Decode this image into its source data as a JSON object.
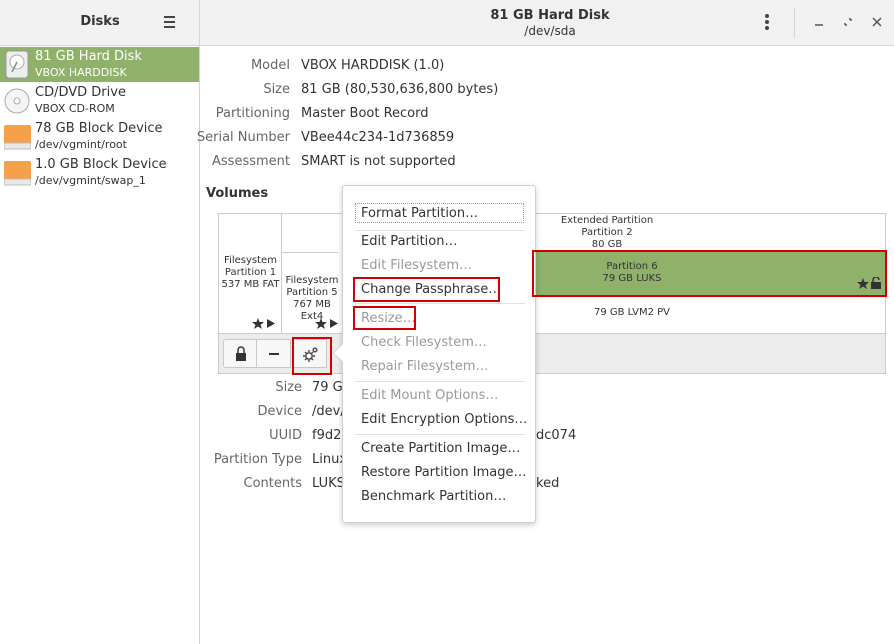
{
  "sidebar": {
    "title": "Disks",
    "menu_icon": "hamburger-icon",
    "items": [
      {
        "name": "81 GB Hard Disk",
        "sub": "VBOX HARDDISK",
        "icon": "harddisk-icon",
        "selected": true
      },
      {
        "name": "CD/DVD Drive",
        "sub": "VBOX CD-ROM",
        "icon": "optical-disc-icon"
      },
      {
        "name": "78 GB Block Device",
        "sub": "/dev/vgmint/root",
        "icon": "block-device-icon"
      },
      {
        "name": "1.0 GB Block Device",
        "sub": "/dev/vgmint/swap_1",
        "icon": "block-device-icon"
      }
    ]
  },
  "header": {
    "title": "81 GB Hard Disk",
    "subtitle": "/dev/sda",
    "icons": [
      "kebab-menu-icon",
      "minimize-icon",
      "restore-icon",
      "close-icon"
    ]
  },
  "disk_info": {
    "model_label": "Model",
    "model": "VBOX HARDDISK (1.0)",
    "size_label": "Size",
    "size": "81 GB (80,530,636,800 bytes)",
    "partitioning_label": "Partitioning",
    "partitioning": "Master Boot Record",
    "serial_label": "Serial Number",
    "serial": "VBee44c234-1d736859",
    "assessment_label": "Assessment",
    "assessment": "SMART is not supported"
  },
  "volumes": {
    "label": "Volumes",
    "p1": {
      "l1": "Filesystem",
      "l2": "Partition 1",
      "l3": "537 MB FAT"
    },
    "p5": {
      "l1": "Filesystem",
      "l2": "Partition 5",
      "l3": "767 MB Ext4"
    },
    "ext": {
      "l1": "Extended Partition",
      "l2": "Partition 2",
      "l3": "80 GB"
    },
    "p6": {
      "l1": "Partition 6",
      "l2": "79 GB LUKS"
    },
    "lvm": "79 GB LVM2 PV",
    "toolbar_icons": [
      "lock-icon",
      "minus-icon",
      "gears-icon"
    ]
  },
  "selected_partition": {
    "size_label": "Size",
    "size": "79 GB",
    "device_label": "Device",
    "device": "/dev/",
    "uuid_label": "UUID",
    "uuid_start": "f9d2",
    "uuid_end": "dc074",
    "type_label": "Partition Type",
    "type": "Linux",
    "contents_label": "Contents",
    "contents_start": "LUKS",
    "contents_end": "ked"
  },
  "menu": {
    "items": [
      {
        "label": "Format Partition…",
        "disabled": false
      },
      {
        "label": "Edit Partition…",
        "disabled": false
      },
      {
        "label": "Edit Filesystem…",
        "disabled": true
      },
      {
        "label": "Change Passphrase…",
        "disabled": false
      },
      {
        "label": "Resize…",
        "disabled": true
      },
      {
        "label": "Check Filesystem…",
        "disabled": true
      },
      {
        "label": "Repair Filesystem…",
        "disabled": true
      },
      {
        "label": "Edit Mount Options…",
        "disabled": true
      },
      {
        "label": "Edit Encryption Options…",
        "disabled": false
      },
      {
        "label": "Create Partition Image…",
        "disabled": false
      },
      {
        "label": "Restore Partition Image…",
        "disabled": false
      },
      {
        "label": "Benchmark Partition…",
        "disabled": false
      }
    ]
  },
  "colors": {
    "accent": "#8fb16a",
    "highlight": "#d40000",
    "block_device": "#f7a04a"
  }
}
